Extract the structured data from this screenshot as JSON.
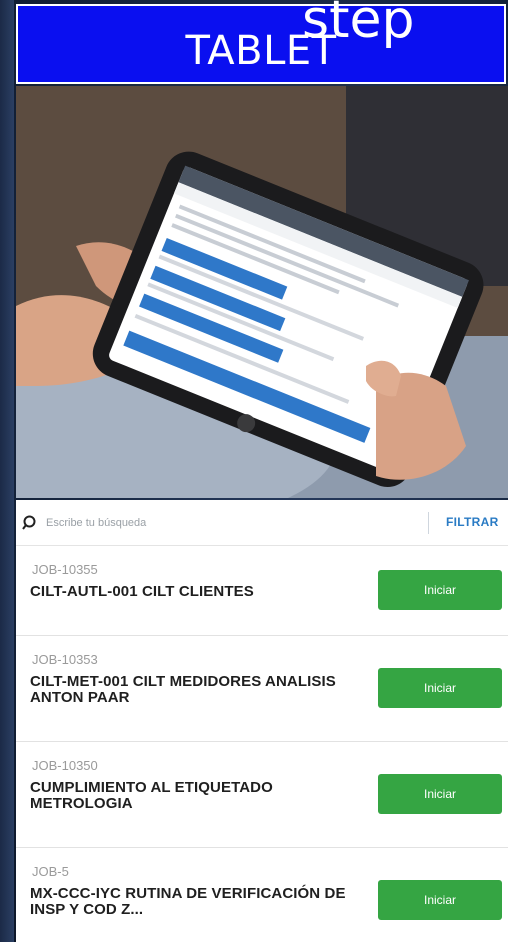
{
  "banner": {
    "title": "TABLET",
    "overlay": "step"
  },
  "search": {
    "placeholder": "Escribe tu búsqueda",
    "filter_label": "FILTRAR"
  },
  "jobs": [
    {
      "code": "JOB-10355",
      "title": "CILT-AUTL-001 CILT CLIENTES",
      "action": "Iniciar"
    },
    {
      "code": "JOB-10353",
      "title": "CILT-MET-001 CILT MEDIDORES ANALISIS ANTON PAAR",
      "action": "Iniciar"
    },
    {
      "code": "JOB-10350",
      "title": "CUMPLIMIENTO AL ETIQUETADO METROLOGIA",
      "action": "Iniciar"
    },
    {
      "code": "JOB-5",
      "title": "MX-CCC-IYC RUTINA DE VERIFICACIÓN  DE INSP Y COD Z...",
      "action": "Iniciar"
    }
  ],
  "colors": {
    "banner": "#0a0ff0",
    "start_button": "#35a543",
    "filter_link": "#2a7bc4"
  }
}
